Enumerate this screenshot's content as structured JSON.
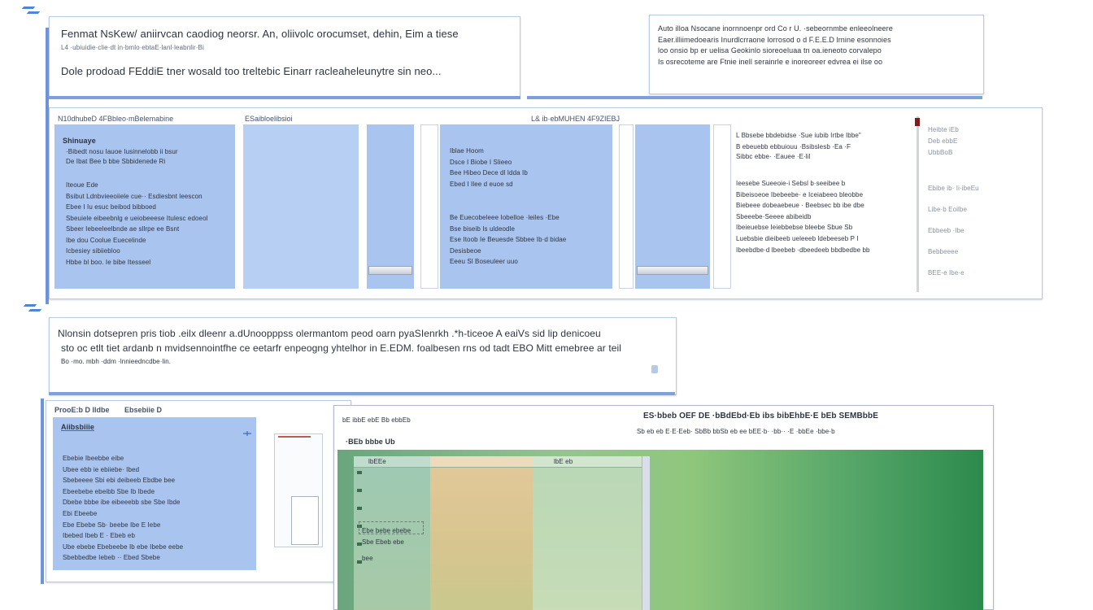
{
  "top_left_note": {
    "line1": "Fenmat NsKew/ aniirvcan caodiog neorsr. An, oliivolc orocumset, dehin, Eim a tiese",
    "line2": "L4 ·ubiuidie·clie·dt in·bmlo·ebtaE·lanl·leabnlir·Bi",
    "line3": "Dole prodoad FEddiE tner wosald too treltebic Einarr racleaheleunytre sin neo..."
  },
  "top_right_note": {
    "lines": [
      "Auto illoa Nsocane inornnoenpr ord Co r U. ·sebeornmbe enleeolneere",
      "Eaer.illiimedoearis Inurdlcrraone lorrosod o d F.E.E.D lrnine esonnoies",
      "loo onsio bp er uelisa Geokinlo sioreoeluaa tn oa.ieneoto corvalepo",
      "Is osrecoteme are Ftnie inell serainrle e inoreoreer edvrea ei ilse oo"
    ]
  },
  "top_window": {
    "left_header": "N10dhubeD 4FBbleo·mBelemabine",
    "right_header": "ESaibloelibsioi",
    "left_panel_title": "Shinuaye",
    "left_panel_intro": [
      "·Bibedt nosu Iauoe Iusinnelobb ii bsur",
      "De Ibat Bee b bbe Sbbidenede Ri"
    ],
    "left_panel_items": [
      "Iteoue Ede",
      "Bsibut Ldnbvieeoiiele cue·· Esdiesbnt leescon",
      "Ebee I Iu esuc beibod bibboed",
      "Sbeuiele eibeebnlg e ueiobeeese Itulesc edoeol",
      "Sbeer Iebeeleelbnde ae sllrpe ee Bsnt",
      "Ibe dou Coolue Euecelinde",
      "Icbesiey sibiiebloo",
      "Hbbe bl boo. Ie bibe Itesseel"
    ],
    "mid_panel_items_a": [
      "Iblae Hoom",
      "Dsce I Biobe I Slieeo",
      "Bee Hibeo Dece dl Idda Ib",
      "Ebed I Ilee d euoe sd"
    ],
    "mid_panel_items_b": [
      "Be Euecobeleee Iobelloe ·leiles ·Ebe",
      "Bse biseib Is uldeodle",
      "Ese Itoob Ie Beuesde Sbbee Ib·d bidae",
      "Desisbeoe",
      "Eeeu Sl Boseuleer uuo"
    ],
    "mid_header_2": "L& ib·ebMUHEN 4F9ZIEBJ",
    "right_col_title": "L Bbsebe bbdebidse ·Sue iubib Irtbe Ibbe\"",
    "right_col_sub": [
      "B ebeuebb ebbuiouu ·Bsibslesb ·Ea ·F",
      "Sibbc ebbe· ·Eauee ·E·lil"
    ],
    "right_col_items": [
      "Ieesebe Sueeoie-i Sebsl b·seeibee b",
      "Bibeisoeoe Ibebeebe· e Iceiabeeo bleobbe",
      "Biebeee dobeaebeue · Beebsec bb ibe dbe",
      "Sbeeebe·Seeee abibeidb",
      "Ibeieuebse Ieiebbebse bleebe Sbue Sb",
      "Luebsbie dieibeeb ueleeeb ldebeeseb P I",
      "Ibeebdbe·d lbeebeb ·dbeedeeb bbdbedbe bb"
    ],
    "far_right_items": [
      "Heibte iEb",
      "Deb ebbE",
      "UbbBoB",
      "Ebibe ib· Ii·ibeEu",
      "Libe·b Eoilbe",
      "Ebbeeb ·Ibe",
      "Bebbeeee",
      "BEE·e Ibe·e"
    ]
  },
  "middle_note": {
    "line1": "Nlonsin dotsepren pris tiob .eilx dleenr a.dUnoopppss olermantom peod oarn pyaSIenrkh .*h-ticeoe A eaiVs sid lip denicoeu",
    "line2": "sto oc etlt tiet ardanb n mvidsennointfhe ce eetarfr enpeogng yhtelhor in E.EDM. foalbesen rns od tadt EBO Mitt emebree ar teil",
    "line3": "Bo ·mo. mbh ·ddm ·lnnieedncdbe·lin."
  },
  "bottom_left_window": {
    "header_left": "ProoE:b D lldbe",
    "header_right": "Ebsebiie D",
    "panel_title": "Aiibsbiiie",
    "items": [
      "Ebebie Ibeebbe eibe",
      "Ubee ebb ie ebiiebe· Ibed",
      "Sbebeeee Sbi ebi deibeeb Ebdbe bee",
      "Ebeebebe ebeibb Sbe Ib Ibede",
      "Dbebe bbbe ibe eibeeebb sbe Sbe Ibde",
      "Ebi Ebeebe",
      "Ebe Ebebe Sb· beebe Ibe E Iebe",
      "Ibebed Ibeb E · Ebeb eb",
      "Ube ebebe Ebebeebe Ib ebe Ibebe eebe",
      "Sbebbedbe Iebeb ·· Ebed Sbebe"
    ]
  },
  "bottom_right_window": {
    "title": "ES·bbeb OEF DE ·bBdEbd·Eb ibs bibEhbE·E bEb SEMBbbE",
    "sub": "Sb eb eb E·E·Eeb· SbBb bbSb eb ee bEE·b· ·bb·· ·E ·bbEe ·bbe·b",
    "tabs_left": "bE ibbE ebE Bb ebbEb",
    "toolbar_left": "·BEb bbbe Ub",
    "col1": "lbEEe",
    "col2": "lbE eb",
    "overlay_label_1": "Ebe bebe ebebe",
    "overlay_label_2": "Sbe Ebeb ebe",
    "overlay_label_3": "bee"
  },
  "colors": {
    "accent_blue": "#7ea0dd",
    "panel_blue": "#a9c4ee",
    "green_dark": "#2c8a4d",
    "tan": "#e4c89a"
  }
}
